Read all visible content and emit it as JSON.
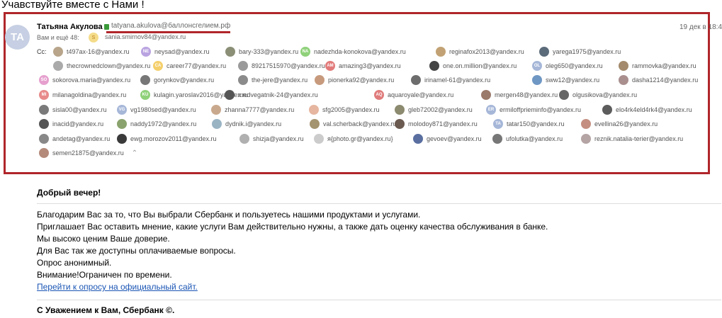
{
  "subject": "Учавствуйте вместе с Нами !",
  "sender": {
    "avatar_initials": "TA",
    "name": "Татьяна Акулова",
    "email": "tatyana.akulova@баллонсгелием.рф",
    "date": "19 дек в 18:4"
  },
  "to": {
    "label": "Вам и ещё 48:",
    "avatar": "S",
    "email": "sania.smirnov84@yandex.ru"
  },
  "cc_label": "Cc:",
  "cc": [
    {
      "email": "t497ax-16@yandex.ru",
      "initials": "",
      "color": "#b8a58a"
    },
    {
      "email": "neysad@yandex.ru",
      "initials": "NE",
      "color": "#b9a3e0"
    },
    {
      "email": "bary-333@yandex.ru",
      "initials": "",
      "color": "#8a8f76"
    },
    {
      "email": "nadezhda-konokova@yandex.ru",
      "initials": "NA",
      "color": "#8fd17a"
    },
    {
      "email": "reginafox2013@yandex.ru",
      "initials": "",
      "color": "#c2a274"
    },
    {
      "email": "yarega1975@yandex.ru",
      "initials": "",
      "color": "#5b6b7a"
    },
    {
      "email": "thecrownedclown@yandex.ru",
      "initials": "",
      "color": "#aaaaaa"
    },
    {
      "email": "career77@yandex.ru",
      "initials": "CA",
      "color": "#f4cf6c"
    },
    {
      "email": "89217515970@yandex.ru",
      "initials": "",
      "color": "#9a9a9a"
    },
    {
      "email": "amazing3@yandex.ru",
      "initials": "AM",
      "color": "#e27b7b"
    },
    {
      "email": "one.on.million@yandex.ru",
      "initials": "",
      "color": "#444444"
    },
    {
      "email": "oleg650@yandex.ru",
      "initials": "OL",
      "color": "#a6b7d8"
    },
    {
      "email": "rammovka@yandex.ru",
      "initials": "",
      "color": "#a38a6c"
    },
    {
      "email": "sokorova.maria@yandex.ru",
      "initials": "SO",
      "color": "#e6a0ce"
    },
    {
      "email": "gorynkov@yandex.ru",
      "initials": "",
      "color": "#777777"
    },
    {
      "email": "the-jere@yandex.ru",
      "initials": "",
      "color": "#8b8b8b"
    },
    {
      "email": "pionerka92@yandex.ru",
      "initials": "",
      "color": "#c79a7d"
    },
    {
      "email": "irinamel-61@yandex.ru",
      "initials": "",
      "color": "#6d6d6d"
    },
    {
      "email": "sww12@yandex.ru",
      "initials": "",
      "color": "#6f97c4"
    },
    {
      "email": "dasha1214@yandex.ru",
      "initials": "",
      "color": "#aa8f8f"
    },
    {
      "email": "milanagoldina@yandex.ru",
      "initials": "MI",
      "color": "#e88a8a"
    },
    {
      "email": "kulagin.yaroslav2016@yandex.ru",
      "initials": "KU",
      "color": "#8fd17a"
    },
    {
      "email": "medvegatnik-24@yandex.ru",
      "initials": "",
      "color": "#555555"
    },
    {
      "email": "aquaroyale@yandex.ru",
      "initials": "AQ",
      "color": "#e07b7b"
    },
    {
      "email": "mergen48@yandex.ru",
      "initials": "",
      "color": "#9a7a6a"
    },
    {
      "email": "olgusikova@yandex.ru",
      "initials": "",
      "color": "#666666"
    },
    {
      "email": "sisla00@yandex.ru",
      "initials": "",
      "color": "#7a7a7a"
    },
    {
      "email": "vg1980sed@yandex.ru",
      "initials": "VG",
      "color": "#a6b7d8"
    },
    {
      "email": "zhanna7777@yandex.ru",
      "initials": "",
      "color": "#c9a98d"
    },
    {
      "email": "sfg2005@yandex.ru",
      "initials": "",
      "color": "#e6b6a0"
    },
    {
      "email": "gleb72002@yandex.ru",
      "initials": "",
      "color": "#8c8a6f"
    },
    {
      "email": "ermiloffprieminfo@yandex.ru",
      "initials": "ER",
      "color": "#a6b7d8"
    },
    {
      "email": "elo4rk4eld4rk4@yandex.ru",
      "initials": "",
      "color": "#5c5c5c"
    },
    {
      "email": "inacid@yandex.ru",
      "initials": "",
      "color": "#555555"
    },
    {
      "email": "naddy1972@yandex.ru",
      "initials": "",
      "color": "#8aa36e"
    },
    {
      "email": "dydnik.i@yandex.ru",
      "initials": "",
      "color": "#9ab4c4"
    },
    {
      "email": "val.scherback@yandex.ru",
      "initials": "",
      "color": "#a4946f"
    },
    {
      "email": "molodoy871@yandex.ru",
      "initials": "",
      "color": "#6b5a50"
    },
    {
      "email": "tatar150@yandex.ru",
      "initials": "TA",
      "color": "#a6b7d8"
    },
    {
      "email": "evellina26@yandex.ru",
      "initials": "",
      "color": "#c48f80"
    },
    {
      "email": "andetag@yandex.ru",
      "initials": "",
      "color": "#888888"
    },
    {
      "email": "ewg.morozov2011@yandex.ru",
      "initials": "",
      "color": "#3a3a3a"
    },
    {
      "email": "shizja@yandex.ru",
      "initials": "",
      "color": "#b0b0b0"
    },
    {
      "email": "я{photo.gr@yandex.ru}",
      "initials": "",
      "color": "#cccccc"
    },
    {
      "email": "gevoev@yandex.ru",
      "initials": "",
      "color": "#5a6fa0"
    },
    {
      "email": "ufolutka@yandex.ru",
      "initials": "",
      "color": "#777777"
    },
    {
      "email": "reznik.natalia-terier@yandex.ru",
      "initials": "",
      "color": "#b5a4a4"
    },
    {
      "email": "semen21875@yandex.ru",
      "initials": "",
      "color": "#b48a7a"
    }
  ],
  "greeting": "Добрый вечер!",
  "lines": [
    "Благодарим Вас за то, что Вы выбрали Сбербанк и пользуетесь нашими продуктами и услугами.",
    "Приглашает Вас оставить мнение, какие услуги Вам действительно нужны, а также дать оценку качества обслуживания в банке.",
    "Мы высоко ценим Ваше доверие.",
    "Для Вас так же доступны оплачиваемые вопросы.",
    "Опрос анонимный.",
    "Внимание!Ограничен по времени."
  ],
  "link": "Перейти к опросу на официальный сайт.",
  "signature": "С Уважением к Вам, Сбербанк ©.",
  "colors": {
    "highlight": "#b0262b",
    "link": "#1a55b4"
  }
}
